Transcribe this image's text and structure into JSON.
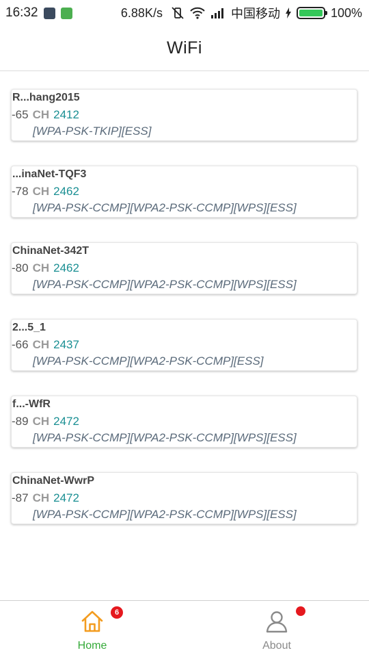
{
  "status_bar": {
    "time": "16:32",
    "net_speed": "6.88K/s",
    "carrier": "中国移动",
    "battery": "100%"
  },
  "app_bar": {
    "title": "WiFi"
  },
  "networks": [
    {
      "ssid": "R...hang2015",
      "rssi": "-65",
      "ch_label": "CH",
      "freq": "2412",
      "caps": "[WPA-PSK-TKIP][ESS]"
    },
    {
      "ssid": "...inaNet-TQF3",
      "rssi": "-78",
      "ch_label": "CH",
      "freq": "2462",
      "caps": "[WPA-PSK-CCMP][WPA2-PSK-CCMP][WPS][ESS]"
    },
    {
      "ssid": "ChinaNet-342T",
      "rssi": "-80",
      "ch_label": "CH",
      "freq": "2462",
      "caps": "[WPA-PSK-CCMP][WPA2-PSK-CCMP][WPS][ESS]"
    },
    {
      "ssid": "2...5_1",
      "rssi": "-66",
      "ch_label": "CH",
      "freq": "2437",
      "caps": "[WPA-PSK-CCMP][WPA2-PSK-CCMP][ESS]"
    },
    {
      "ssid": "f...-WfR",
      "rssi": "-89",
      "ch_label": "CH",
      "freq": "2472",
      "caps": "[WPA-PSK-CCMP][WPA2-PSK-CCMP][WPS][ESS]"
    },
    {
      "ssid": "ChinaNet-WwrP",
      "rssi": "-87",
      "ch_label": "CH",
      "freq": "2472",
      "caps": "[WPA-PSK-CCMP][WPA2-PSK-CCMP][WPS][ESS]"
    }
  ],
  "bottom_nav": {
    "home_label": "Home",
    "home_badge": "6",
    "about_label": "About",
    "active_color": "#33a937",
    "home_icon": "home-icon",
    "about_icon": "person-icon"
  }
}
